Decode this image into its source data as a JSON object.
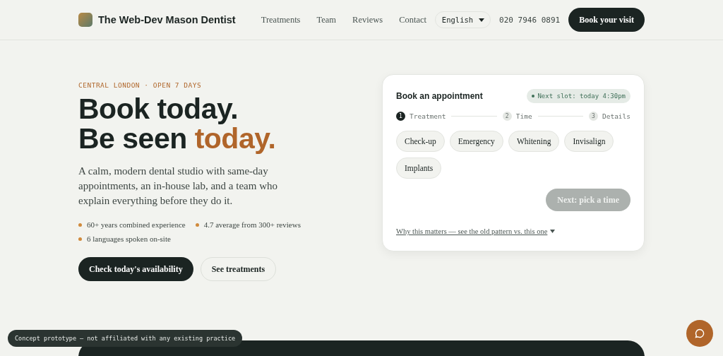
{
  "header": {
    "brand": "The Web-Dev Mason Dentist",
    "nav": [
      "Treatments",
      "Team",
      "Reviews",
      "Contact"
    ],
    "language": "English",
    "phone": "020 7946 0891",
    "cta": "Book your visit"
  },
  "hero": {
    "eyebrow": "CENTRAL LONDON · OPEN 7 DAYS",
    "headline": [
      "Book today.",
      "Be seen *today.*"
    ],
    "lead": "A calm, modern dental studio with same-day appointments, an in-house lab, and a team who explain everything before they do it.",
    "facts": [
      "60+ years combined experience",
      "4.7 average from 300+ reviews",
      "6 languages spoken on-site"
    ],
    "buttons": [
      {
        "label": "Check today's availability",
        "kind": "primary"
      },
      {
        "label": "See treatments",
        "kind": "secondary"
      }
    ]
  },
  "booking": {
    "title": "Book an appointment",
    "next_slot": "Next slot: today 4:30pm",
    "steps": [
      {
        "number": "1",
        "label": "Treatment",
        "selected": true
      },
      {
        "number": "2",
        "label": "Time",
        "selected": false
      },
      {
        "number": "3",
        "label": "Details",
        "selected": false
      }
    ],
    "treatments": [
      {
        "label": "Check-up",
        "selected": false
      },
      {
        "label": "Emergency",
        "selected": false
      },
      {
        "label": "Whitening",
        "selected": false
      },
      {
        "label": "Invisalign",
        "selected": false
      },
      {
        "label": "Implants",
        "selected": false
      }
    ],
    "next": {
      "label": "Next: pick a time",
      "disabled": true
    },
    "disclosure": {
      "label": "Why this matters — see the old pattern vs. this one",
      "expanded": false
    }
  },
  "notice": "Concept prototype — not affiliated with any existing practice"
}
